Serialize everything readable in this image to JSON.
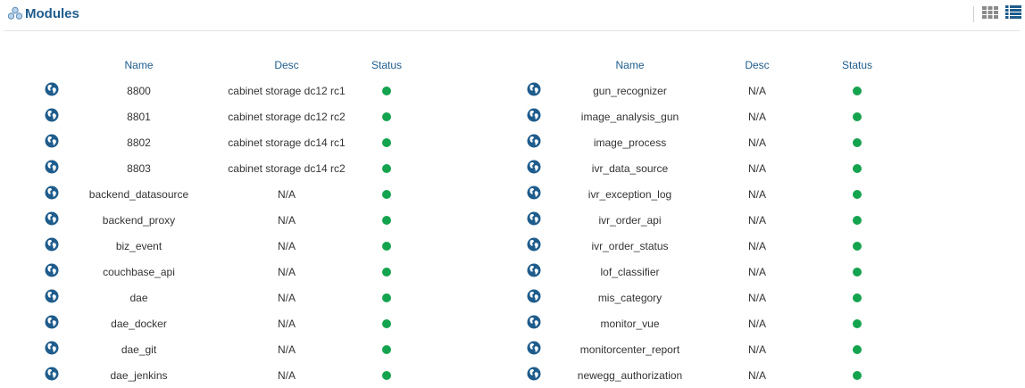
{
  "header": {
    "title": "Modules",
    "title_icon": "modules-icon",
    "view_buttons": [
      "grid-view-icon",
      "list-view-icon"
    ]
  },
  "columns": {
    "name": "Name",
    "desc": "Desc",
    "status": "Status"
  },
  "status_color": "#14a34e",
  "accent_color": "#1e5c8c",
  "left_modules": [
    {
      "name": "8800",
      "desc": "cabinet storage dc12 rc1",
      "status": "up"
    },
    {
      "name": "8801",
      "desc": "cabinet storage dc12 rc2",
      "status": "up"
    },
    {
      "name": "8802",
      "desc": "cabinet storage dc14 rc1",
      "status": "up"
    },
    {
      "name": "8803",
      "desc": "cabinet storage dc14 rc2",
      "status": "up"
    },
    {
      "name": "backend_datasource",
      "desc": "N/A",
      "status": "up"
    },
    {
      "name": "backend_proxy",
      "desc": "N/A",
      "status": "up"
    },
    {
      "name": "biz_event",
      "desc": "N/A",
      "status": "up"
    },
    {
      "name": "couchbase_api",
      "desc": "N/A",
      "status": "up"
    },
    {
      "name": "dae",
      "desc": "N/A",
      "status": "up"
    },
    {
      "name": "dae_docker",
      "desc": "N/A",
      "status": "up"
    },
    {
      "name": "dae_git",
      "desc": "N/A",
      "status": "up"
    },
    {
      "name": "dae_jenkins",
      "desc": "N/A",
      "status": "up"
    }
  ],
  "right_modules": [
    {
      "name": "gun_recognizer",
      "desc": "N/A",
      "status": "up"
    },
    {
      "name": "image_analysis_gun",
      "desc": "N/A",
      "status": "up"
    },
    {
      "name": "image_process",
      "desc": "N/A",
      "status": "up"
    },
    {
      "name": "ivr_data_source",
      "desc": "N/A",
      "status": "up"
    },
    {
      "name": "ivr_exception_log",
      "desc": "N/A",
      "status": "up"
    },
    {
      "name": "ivr_order_api",
      "desc": "N/A",
      "status": "up"
    },
    {
      "name": "ivr_order_status",
      "desc": "N/A",
      "status": "up"
    },
    {
      "name": "lof_classifier",
      "desc": "N/A",
      "status": "up"
    },
    {
      "name": "mis_category",
      "desc": "N/A",
      "status": "up"
    },
    {
      "name": "monitor_vue",
      "desc": "N/A",
      "status": "up"
    },
    {
      "name": "monitorcenter_report",
      "desc": "N/A",
      "status": "up"
    },
    {
      "name": "newegg_authorization",
      "desc": "N/A",
      "status": "up"
    }
  ]
}
